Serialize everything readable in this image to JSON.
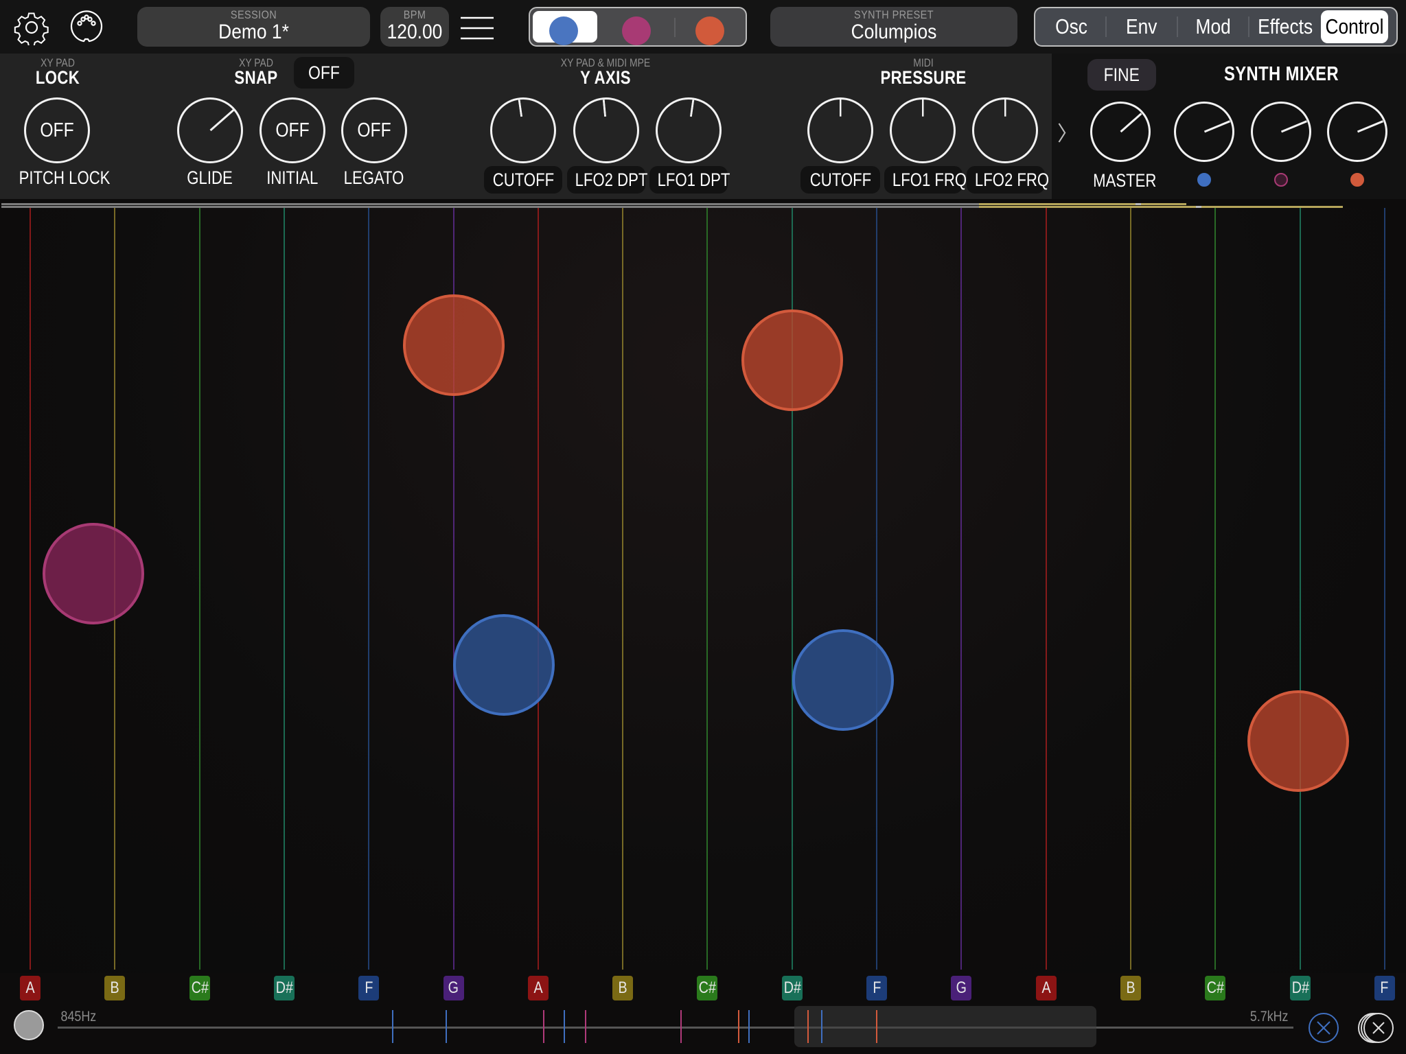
{
  "topbar": {
    "settings_icon": "gear-icon",
    "midi_icon": "midi-din-connector-icon",
    "session": {
      "caption": "SESSION",
      "value": "Demo 1*"
    },
    "bpm": {
      "caption": "BPM",
      "value": "120.00"
    },
    "menu_icon": "hamburger-menu-icon",
    "synths": [
      {
        "name": "synth-1",
        "color": "#4a75c0",
        "selected": true
      },
      {
        "name": "synth-2",
        "color": "#a83a74",
        "selected": false
      },
      {
        "name": "synth-3",
        "color": "#d15a3b",
        "selected": false
      }
    ],
    "preset": {
      "caption": "SYNTH PRESET",
      "value": "Columpios"
    },
    "tabs": [
      {
        "label": "Osc",
        "active": false
      },
      {
        "label": "Env",
        "active": false
      },
      {
        "label": "Mod",
        "active": false
      },
      {
        "label": "Effects",
        "active": false
      },
      {
        "label": "Control",
        "active": true
      }
    ]
  },
  "control_panel": {
    "lock": {
      "caption": "XY PAD",
      "title": "LOCK",
      "knob": {
        "label": "PITCH LOCK",
        "value": "OFF"
      }
    },
    "snap": {
      "caption": "XY PAD",
      "title": "SNAP",
      "toggle": "OFF",
      "knobs": [
        {
          "label": "GLIDE",
          "value": 0.68
        },
        {
          "label": "INITIAL",
          "value": "OFF"
        },
        {
          "label": "LEGATO",
          "value": "OFF"
        }
      ]
    },
    "y_axis": {
      "caption": "XY PAD & MIDI MPE",
      "title": "Y AXIS",
      "knobs": [
        {
          "label": "CUTOFF",
          "value": 0.47
        },
        {
          "label": "LFO2 DPT",
          "value": 0.48
        },
        {
          "label": "LFO1 DPT",
          "value": 0.53
        }
      ]
    },
    "pressure": {
      "caption": "MIDI",
      "title": "PRESSURE",
      "knobs": [
        {
          "label": "CUTOFF",
          "value": 0.5
        },
        {
          "label": "LFO1 FRQ",
          "value": 0.5
        },
        {
          "label": "LFO2 FRQ",
          "value": 0.5
        }
      ]
    },
    "expand_icon": "chevron-right-icon"
  },
  "synth_mixer": {
    "fine_label": "FINE",
    "title": "SYNTH MIXER",
    "master": {
      "label": "MASTER",
      "value": 0.68
    },
    "channels": [
      {
        "name": "synth-1-level",
        "color": "#3f6fc0",
        "value": 0.75,
        "dot_filled": true
      },
      {
        "name": "synth-2-level",
        "color": "#a83a74",
        "value": 0.75,
        "dot_filled": false
      },
      {
        "name": "synth-3-level",
        "color": "#d15a3b",
        "value": 0.75,
        "dot_filled": true
      }
    ]
  },
  "meters": {
    "left": 0.67,
    "right": 0.67
  },
  "pad": {
    "notes": [
      {
        "label": "A",
        "color": "#8c1414",
        "line": "#9a1c1c"
      },
      {
        "label": "B",
        "color": "#7a6a14",
        "line": "#8a7a2a"
      },
      {
        "label": "C#",
        "color": "#2a7a1c",
        "line": "#2e7a2a"
      },
      {
        "label": "D#",
        "color": "#187058",
        "line": "#1e7a5e"
      },
      {
        "label": "F",
        "color": "#1c3c78",
        "line": "#24467e"
      },
      {
        "label": "G",
        "color": "#4a2078",
        "line": "#5a2a8a"
      },
      {
        "label": "A",
        "color": "#8c1414",
        "line": "#9a1c1c"
      },
      {
        "label": "B",
        "color": "#7a6a14",
        "line": "#8a7a2a"
      },
      {
        "label": "C#",
        "color": "#2a7a1c",
        "line": "#2e7a2a"
      },
      {
        "label": "D#",
        "color": "#187058",
        "line": "#1e7a5e"
      },
      {
        "label": "F",
        "color": "#1c3c78",
        "line": "#24467e"
      },
      {
        "label": "G",
        "color": "#4a2078",
        "line": "#5a2a8a"
      },
      {
        "label": "A",
        "color": "#8c1414",
        "line": "#9a1c1c"
      },
      {
        "label": "B",
        "color": "#7a6a14",
        "line": "#8a7a2a"
      },
      {
        "label": "C#",
        "color": "#2a7a1c",
        "line": "#2e7a2a"
      },
      {
        "label": "D#",
        "color": "#187058",
        "line": "#1e7a5e"
      },
      {
        "label": "F",
        "color": "#1c3c78",
        "line": "#24467e"
      }
    ],
    "touches": [
      {
        "synth": "synth-3",
        "note_index": 5.0,
        "y": 0.09,
        "fill": "rgba(190,70,45,0.78)",
        "stroke": "#d35a3c"
      },
      {
        "synth": "synth-3",
        "note_index": 9.0,
        "y": 0.11,
        "fill": "rgba(190,70,45,0.78)",
        "stroke": "#d35a3c"
      },
      {
        "synth": "synth-2",
        "note_index": 0.75,
        "y": 0.39,
        "fill": "rgba(130,35,85,0.82)",
        "stroke": "#a83a74"
      },
      {
        "synth": "synth-1",
        "note_index": 5.6,
        "y": 0.51,
        "fill": "rgba(45,80,140,0.85)",
        "stroke": "#3f6fc0"
      },
      {
        "synth": "synth-1",
        "note_index": 9.6,
        "y": 0.53,
        "fill": "rgba(45,80,140,0.85)",
        "stroke": "#3f6fc0"
      },
      {
        "synth": "synth-3",
        "note_index": 14.98,
        "y": 0.61,
        "fill": "rgba(190,70,45,0.78)",
        "stroke": "#d35a3c"
      }
    ]
  },
  "bottom": {
    "range_start_label": "845Hz",
    "range_end_label": "5.7kHz",
    "handle_icon": "range-handle",
    "clear_synth_icon": "clear-synth-touches-icon",
    "clear_all_icon": "clear-all-touches-icon",
    "ticks": [
      {
        "pos": 0.238,
        "color": "#3f6fc0"
      },
      {
        "pos": 0.276,
        "color": "#3f6fc0"
      },
      {
        "pos": 0.345,
        "color": "#b03a7a"
      },
      {
        "pos": 0.36,
        "color": "#3f6fc0"
      },
      {
        "pos": 0.375,
        "color": "#b03a7a"
      },
      {
        "pos": 0.443,
        "color": "#b03a7a"
      },
      {
        "pos": 0.484,
        "color": "#d35a3c"
      },
      {
        "pos": 0.491,
        "color": "#3f6fc0"
      },
      {
        "pos": 0.533,
        "color": "#d35a3c"
      },
      {
        "pos": 0.543,
        "color": "#3f6fc0"
      },
      {
        "pos": 0.582,
        "color": "#d35a3c"
      }
    ]
  }
}
